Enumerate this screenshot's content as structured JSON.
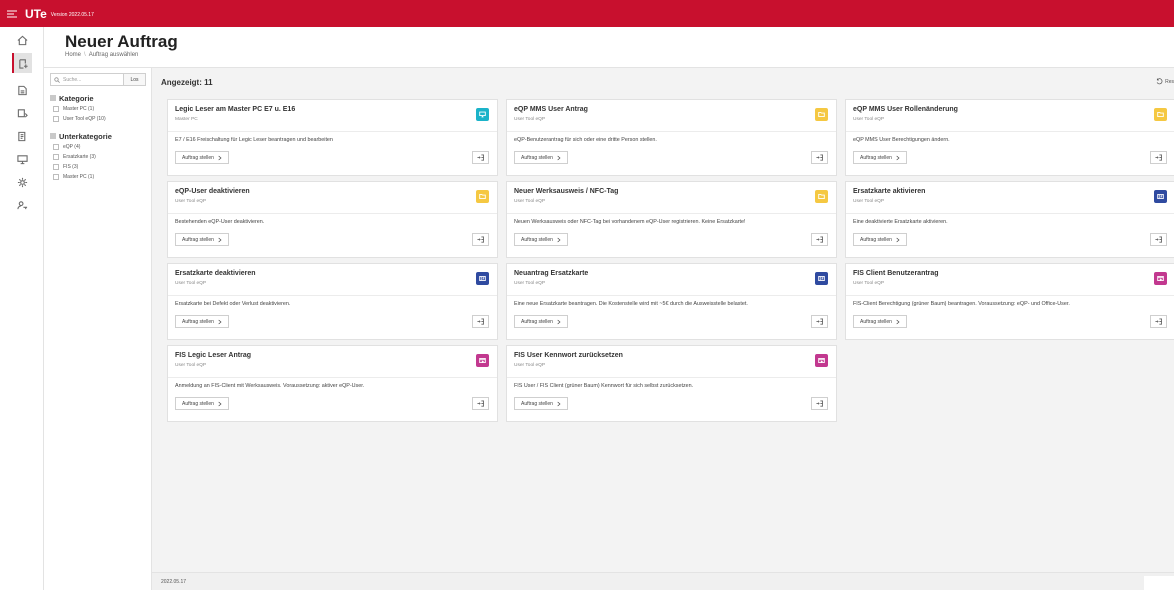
{
  "topbar": {
    "app_name": "UTe",
    "version": "Version 2022.05.17"
  },
  "iconbar": [
    "home-icon",
    "new-order-icon",
    "order-list-icon",
    "user-card-icon",
    "document-icon",
    "monitor-icon",
    "settings-icon",
    "user-key-icon"
  ],
  "header": {
    "title": "Neuer Auftrag",
    "crumb_home": "Home",
    "crumb_sep": "\\",
    "crumb_current": "Auftrag auswählen"
  },
  "filter": {
    "search_placeholder": "Suche...",
    "search_button": "Los",
    "kategorie": {
      "title": "Kategorie",
      "items": [
        "Master PC (1)",
        "User Tool eQP (10)"
      ]
    },
    "unterkategorie": {
      "title": "Unterkategorie",
      "items": [
        "eQP (4)",
        "Ersatzkarte (3)",
        "FIS (3)",
        "Master PC (1)"
      ]
    }
  },
  "main": {
    "count_label": "Angezeigt: 11",
    "reset_label": "Res"
  },
  "cards": [
    {
      "title": "Legic Leser am Master PC E7 u. E16",
      "subtitle": "Master PC",
      "desc": "E7 / E16 Freischaltung für Legic Leser beantragen und bearbeiten",
      "button": "Auftrag stellen",
      "icon": "monitor-icon",
      "color": "#1bb3c9"
    },
    {
      "title": "eQP MMS User Antrag",
      "subtitle": "User Tool eQP",
      "desc": "eQP-Benutzerantrag für sich oder eine dritte Person stellen.",
      "button": "Auftrag stellen",
      "icon": "folder-icon",
      "color": "#f5c842"
    },
    {
      "title": "eQP MMS User Rollenänderung",
      "subtitle": "User Tool eQP",
      "desc": "eQP MMS User Berechtigungen ändern.",
      "button": "Auftrag stellen",
      "icon": "folder-icon",
      "color": "#f5c842"
    },
    {
      "title": "eQP-User deaktivieren",
      "subtitle": "User Tool eQP",
      "desc": "Bestehenden eQP-User deaktivieren.",
      "button": "Auftrag stellen",
      "icon": "folder-icon",
      "color": "#f5c842"
    },
    {
      "title": "Neuer Werksausweis / NFC-Tag",
      "subtitle": "User Tool eQP",
      "desc": "Neuen Werksausweis oder NFC-Tag bei vorhandenem eQP-User registrieren. Keine Ersatzkarte!",
      "button": "Auftrag stellen",
      "icon": "folder-icon",
      "color": "#f5c842"
    },
    {
      "title": "Ersatzkarte aktivieren",
      "subtitle": "User Tool eQP",
      "desc": "Eine deaktivierte Ersatzkarte aktivieren.",
      "button": "Auftrag stellen",
      "icon": "id-card-icon",
      "color": "#2f4aa0"
    },
    {
      "title": "Ersatzkarte deaktivieren",
      "subtitle": "User Tool eQP",
      "desc": "Ersatzkarte bei Defekt oder Verlust deaktivieren.",
      "button": "Auftrag stellen",
      "icon": "id-card-icon",
      "color": "#2f4aa0"
    },
    {
      "title": "Neuantrag Ersatzkarte",
      "subtitle": "User Tool eQP",
      "desc": "Eine neue Ersatzkarte beantragen. Die Kostenstelle wird mit ~5€ durch die Ausweisstelle belastet.",
      "button": "Auftrag stellen",
      "icon": "id-card-icon",
      "color": "#2f4aa0"
    },
    {
      "title": "FIS Client Benutzerantrag",
      "subtitle": "User Tool eQP",
      "desc": "FIS-Client Berechtigung (grüner Baum) beantragen. Voraussetzung: eQP- und Office-User.",
      "button": "Auftrag stellen",
      "icon": "window-icon",
      "color": "#c2388f"
    },
    {
      "title": "FIS Legic Leser Antrag",
      "subtitle": "User Tool eQP",
      "desc": "Anmeldung an FIS-Client mit Werksausweis. Voraussetzung: aktiver eQP-User.",
      "button": "Auftrag stellen",
      "icon": "window-icon",
      "color": "#c2388f"
    },
    {
      "title": "FIS User Kennwort zurücksetzen",
      "subtitle": "User Tool eQP",
      "desc": "FIS User / FIS Client (grüner Baum) Kennwort für sich selbst zurücksetzen.",
      "button": "Auftrag stellen",
      "icon": "window-icon",
      "color": "#c2388f"
    }
  ],
  "footer": {
    "version": "2022.05.17"
  }
}
